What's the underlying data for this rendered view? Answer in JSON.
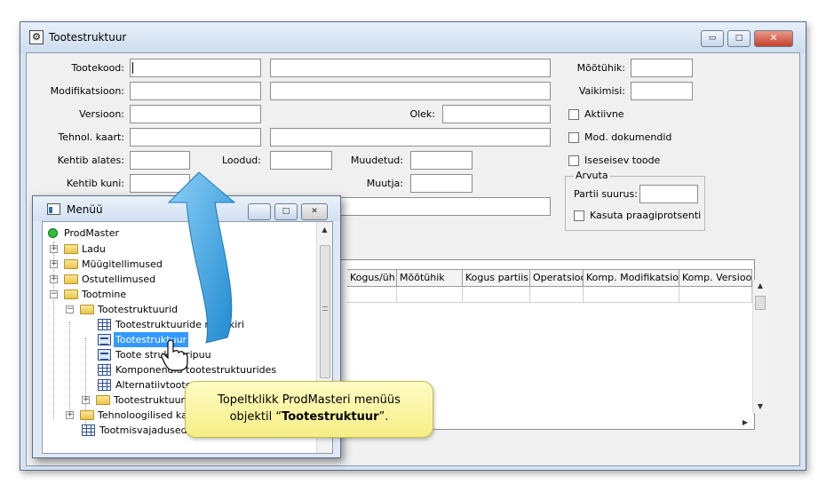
{
  "main_window": {
    "title": "Tootestruktuur",
    "buttons": {
      "minimize": "▭",
      "maximize": "□",
      "close": "✕"
    }
  },
  "form": {
    "tootekood_label": "Tootekood:",
    "modifikatsioon_label": "Modifikatsioon:",
    "versioon_label": "Versioon:",
    "tehnol_kaart_label": "Tehnol. kaart:",
    "kehtib_alates_label": "Kehtib alates:",
    "kehtib_kuni_label": "Kehtib kuni:",
    "loodud_label": "Loodud:",
    "muudetud_label": "Muudetud:",
    "muutja_label": "Muutja:",
    "olek_label": "Olek:",
    "mootuhik_label": "Mõõtühik:",
    "vaikimisi_label": "Vaikimisi:",
    "aktiivne_label": "Aktiivne",
    "mod_dokumendid_label": "Mod. dokumendid",
    "iseseisev_toode_label": "Iseseisev toode",
    "arvuta_group_label": "Arvuta",
    "partii_suurus_label": "Partii suurus:",
    "kasuta_praagiprotsenti_label": "Kasuta praagiprotsenti"
  },
  "grid": {
    "columns": [
      "Kogus/üh",
      "Mõõtühik",
      "Kogus partiis",
      "Operatsioo",
      "Komp. Modifikatsioo",
      "Komp. Versioo"
    ]
  },
  "menu_window": {
    "title": "Menüü",
    "tree": [
      {
        "label": "ProdMaster"
      },
      {
        "label": "Ladu"
      },
      {
        "label": "Müügitellimused"
      },
      {
        "label": "Ostutellimused"
      },
      {
        "label": "Tootmine"
      },
      {
        "label": "Tootestruktuurid"
      },
      {
        "label": "Tootestruktuuride nimekiri"
      },
      {
        "label": "Tootestruktuur"
      },
      {
        "label": "Toote struktuuripuu"
      },
      {
        "label": "Komponendid tootestruktuurides"
      },
      {
        "label": "Alternatiivtooted"
      },
      {
        "label": "Tootestruktuurid"
      },
      {
        "label": "Tehnoloogilised kaardid"
      },
      {
        "label": "Tootmisvajadused"
      }
    ]
  },
  "callout": {
    "line1": "Topeltklikk ProdMasteri menüüs",
    "line2_prefix": "objektil “",
    "line2_bold": "Tootestruktuur",
    "line2_suffix": "”."
  },
  "colors": {
    "arrow": "#3fa4e0",
    "selection": "#3399ff",
    "callout_bg": "#f8f199"
  }
}
